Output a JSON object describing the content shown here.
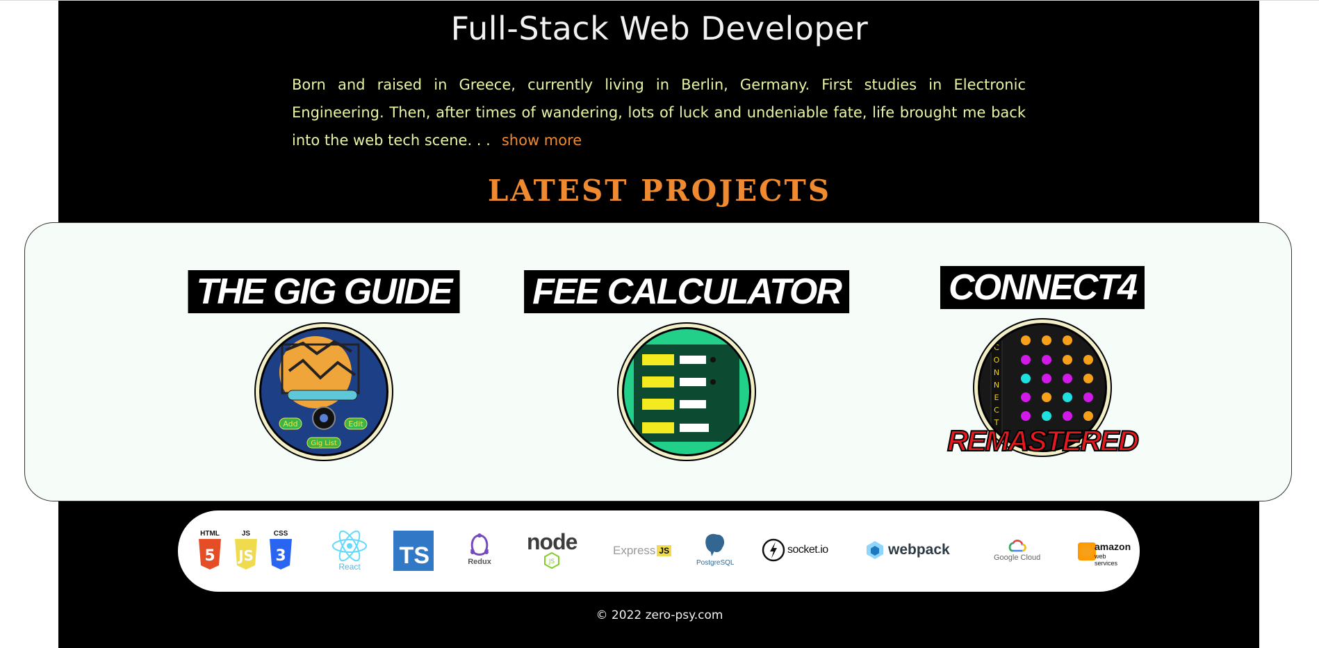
{
  "header": {
    "headline": "Full-Stack Web Developer",
    "bio": "Born and raised in Greece, currently living in Berlin, Germany. First studies in Electronic Engineering. Then, after times of wandering, lots of luck and undeniable fate, life brought me back into the web tech scene. . .",
    "show_more": "show more"
  },
  "projects_section": {
    "title": "LATEST PROJECTS",
    "items": [
      {
        "title": "THE GIG GUIDE",
        "thumb_icon": "gig-guide-logo",
        "buttons": [
          "Add",
          "Edit",
          "Gig List"
        ]
      },
      {
        "title": "FEE CALCULATOR",
        "thumb_icon": "fee-calculator-screenshot"
      },
      {
        "title": "CONNECT4",
        "thumb_icon": "connect4-board",
        "overlay": "REMASTERED",
        "side_letters": "CONNECT"
      }
    ]
  },
  "tech_stack": [
    {
      "name": "HTML",
      "icon": "html5-icon"
    },
    {
      "name": "JS",
      "icon": "js-icon"
    },
    {
      "name": "CSS",
      "icon": "css3-icon"
    },
    {
      "name": "React",
      "icon": "react-icon"
    },
    {
      "name": "TS",
      "icon": "typescript-icon"
    },
    {
      "name": "Redux",
      "icon": "redux-icon"
    },
    {
      "name": "node",
      "icon": "nodejs-icon"
    },
    {
      "name": "Express",
      "icon": "express-icon"
    },
    {
      "name": "PostgreSQL",
      "icon": "postgresql-icon"
    },
    {
      "name": "socket.io",
      "icon": "socketio-icon"
    },
    {
      "name": "webpack",
      "icon": "webpack-icon"
    },
    {
      "name": "Google Cloud",
      "icon": "google-cloud-icon"
    },
    {
      "name": "amazon",
      "sub": "web services",
      "icon": "aws-icon"
    }
  ],
  "footer": {
    "copyright": "© 2022 zero-psy.com"
  },
  "colors": {
    "accent": "#f08a30",
    "bio_text": "#eaf3a6",
    "panel": "#f6fcf7",
    "background": "#000000"
  }
}
